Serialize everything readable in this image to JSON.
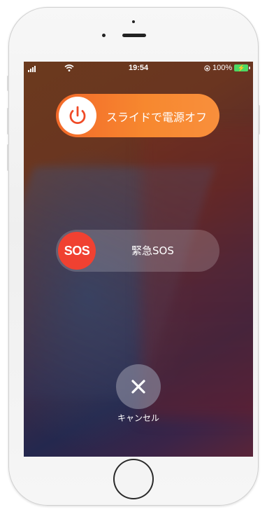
{
  "status_bar": {
    "time": "19:54",
    "battery_percent": "100%",
    "battery_color": "#4cd964",
    "icons": [
      "signal-icon",
      "wifi-icon",
      "orientation-lock-icon",
      "battery-charging-icon"
    ]
  },
  "power_off": {
    "label": "スライドで電源オフ",
    "icon": "power-icon",
    "color": "#f7882f"
  },
  "emergency_sos": {
    "knob_label": "SOS",
    "label": "緊急SOS",
    "color": "#f04131"
  },
  "cancel": {
    "label": "キャンセル",
    "icon": "close-icon"
  }
}
